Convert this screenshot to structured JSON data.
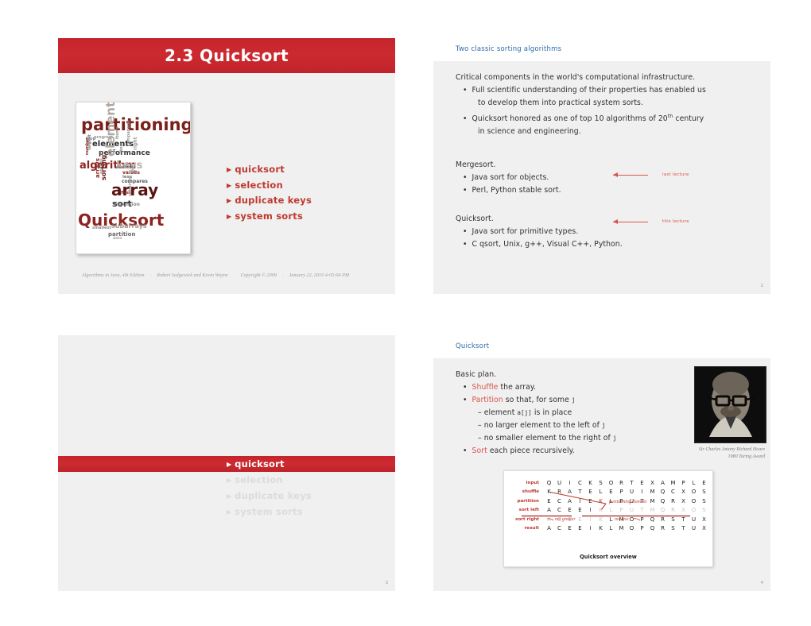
{
  "deck": {
    "accent_red": "#c9252c",
    "accent_blue": "#2d6ca8",
    "accent_salmon": "#d9554d"
  },
  "slide1": {
    "title": "2.3  Quicksort",
    "wordcloud": {
      "words": [
        "partitioning",
        "elements",
        "performance",
        "algorithm",
        "keys",
        "array",
        "sort",
        "Quicksort",
        "element",
        "subarrays",
        "partition",
        "values",
        "compares",
        "less",
        "left",
        "right",
        "largest",
        "program",
        "loop",
        "code",
        "number",
        "comparison",
        "method",
        "smallest",
        "first",
        "recursion",
        "item",
        "items",
        "entries",
        "arrays",
        "sorting",
        "subarray",
        "data"
      ]
    },
    "agenda": [
      {
        "label": "quicksort"
      },
      {
        "label": "selection"
      },
      {
        "label": "duplicate keys"
      },
      {
        "label": "system sorts"
      }
    ],
    "credit": [
      "Algorithms in Java, 4th Edition",
      "Robert Sedgewick and Kevin Wayne",
      "Copyright © 2009",
      "January 22, 2010 4:05:04 PM"
    ]
  },
  "slide2": {
    "header": "Two classic sorting algorithms",
    "page": "2",
    "lead": "Critical components in the world's computational infrastructure.",
    "bullets": [
      "Full scientific understanding of their properties has enabled us",
      "to develop them into practical system sorts.",
      "Quicksort honored as one of top 10 algorithms of 20",
      "th",
      " century",
      "in science and engineering."
    ],
    "mergesort_heading": "Mergesort.",
    "mergesort_items": [
      "Java sort for objects.",
      "Perl, Python stable sort."
    ],
    "mergesort_note": "last lecture",
    "quicksort_heading": "Quicksort.",
    "quicksort_items": [
      "Java sort for primitive types.",
      "C qsort, Unix, g++, Visual C++, Python."
    ],
    "quicksort_note": "this lecture"
  },
  "slide3": {
    "page": "3",
    "agenda": [
      {
        "label": "quicksort",
        "active": true
      },
      {
        "label": "selection",
        "active": false
      },
      {
        "label": "duplicate keys",
        "active": false
      },
      {
        "label": "system sorts",
        "active": false
      }
    ]
  },
  "slide4": {
    "header": "Quicksort",
    "page": "4",
    "plan_heading": "Basic plan.",
    "b1_a": "Shuffle",
    "b1_b": " the array.",
    "b2_a": "Partition",
    "b2_b": " so that, for some ",
    "b2_c": "j",
    "sub1_a": "element ",
    "sub1_b": "a[j]",
    "sub1_c": " is in place",
    "sub2_a": "no larger element to the left of ",
    "sub2_b": "j",
    "sub3_a": "no smaller element to the right of ",
    "sub3_b": "j",
    "b3_a": "Sort",
    "b3_b": " each piece recursively.",
    "photo_caption_1": "Sir Charles Antony Richard Hoare",
    "photo_caption_2": "1980 Turing Award",
    "trace": {
      "caption": "Quicksort overview",
      "annotations": {
        "pivot": "partitioning element",
        "not_greater": "not greater",
        "not_less": "not less"
      },
      "rows": [
        {
          "label": "input",
          "cells": [
            "Q",
            "U",
            "I",
            "C",
            "K",
            "S",
            "O",
            "R",
            "T",
            "E",
            "X",
            "A",
            "M",
            "P",
            "L",
            "E"
          ],
          "dim": [
            0,
            0,
            0,
            0,
            0,
            0,
            0,
            0,
            0,
            0,
            0,
            0,
            0,
            0,
            0,
            0
          ]
        },
        {
          "label": "shuffle",
          "cells": [
            "K",
            "R",
            "A",
            "T",
            "E",
            "L",
            "E",
            "P",
            "U",
            "I",
            "M",
            "Q",
            "C",
            "X",
            "O",
            "S"
          ],
          "dim": [
            0,
            0,
            0,
            0,
            0,
            0,
            0,
            0,
            0,
            0,
            0,
            0,
            0,
            0,
            0,
            0
          ]
        },
        {
          "label": "partition",
          "cells": [
            "E",
            "C",
            "A",
            "I",
            "E",
            "K",
            "L",
            "P",
            "U",
            "T",
            "M",
            "Q",
            "R",
            "X",
            "O",
            "S"
          ],
          "dim": [
            0,
            0,
            0,
            0,
            0,
            2,
            0,
            0,
            0,
            0,
            0,
            0,
            0,
            0,
            0,
            0
          ]
        },
        {
          "label": "sort left",
          "cells": [
            "A",
            "C",
            "E",
            "E",
            "I",
            "K",
            "L",
            "P",
            "U",
            "T",
            "M",
            "Q",
            "R",
            "X",
            "O",
            "S"
          ],
          "dim": [
            0,
            0,
            0,
            0,
            0,
            1,
            1,
            1,
            1,
            1,
            1,
            1,
            1,
            1,
            1,
            1
          ]
        },
        {
          "label": "sort right",
          "cells": [
            "A",
            "C",
            "E",
            "E",
            "I",
            "K",
            "L",
            "M",
            "O",
            "P",
            "Q",
            "R",
            "S",
            "T",
            "U",
            "X"
          ],
          "dim": [
            1,
            1,
            1,
            1,
            1,
            1,
            0,
            0,
            0,
            0,
            0,
            0,
            0,
            0,
            0,
            0
          ]
        },
        {
          "label": "result",
          "cells": [
            "A",
            "C",
            "E",
            "E",
            "I",
            "K",
            "L",
            "M",
            "O",
            "P",
            "Q",
            "R",
            "S",
            "T",
            "U",
            "X"
          ],
          "dim": [
            0,
            0,
            0,
            0,
            0,
            0,
            0,
            0,
            0,
            0,
            0,
            0,
            0,
            0,
            0,
            0
          ]
        }
      ]
    }
  }
}
